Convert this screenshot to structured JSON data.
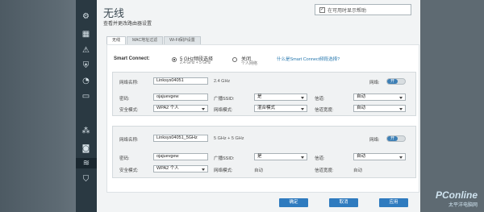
{
  "page": {
    "title": "无线",
    "subtitle": "查看并更改路由器设置",
    "help_checkbox_label": "在可用时显示帮助"
  },
  "tabs": [
    "无线",
    "MAC地址过滤",
    "Wi-Fi保护设置"
  ],
  "smart_connect": {
    "label": "Smart Connect:",
    "option_on": "5 GHz频段选择",
    "option_on_sub": "2.4 GHz + 5 GHz",
    "option_off": "关闭",
    "option_off_sub": "个人网络",
    "link": "什么是Smart Connect频段选择?"
  },
  "band1": {
    "ssid_label": "网络名称:",
    "ssid_value": "Linksys04051",
    "band": "2.4 GHz",
    "network_label": "网络:",
    "toggle": "开",
    "password_label": "密码:",
    "password_value": "ojajuevgew",
    "channel_width_label": "广播SSID:",
    "channel_width_value": "是",
    "channel_label": "信道:",
    "channel_value": "自动",
    "security_label": "安全模式:",
    "security_value": "WPA2 个人",
    "mode_label": "网络模式:",
    "mode_value": "混合模式",
    "width_label": "信道宽度:",
    "width_value": "自动"
  },
  "band2": {
    "ssid_label": "网络名称:",
    "ssid_value": "Linksys04051_5GHz",
    "band": "5 GHz + 5 GHz",
    "network_label": "网络:",
    "toggle": "开",
    "password_label": "密码:",
    "password_value": "ojajuevgew",
    "broadcast_label": "广播SSID:",
    "broadcast_value": "是",
    "channel_label": "信道:",
    "channel_value": "自动",
    "security_label": "安全模式:",
    "security_value": "WPA2 个人",
    "mode_label": "网络模式:",
    "mode_value": "自动",
    "width_label": "信道宽度:",
    "width_value": "自动"
  },
  "buttons": {
    "ok": "确定",
    "cancel": "取消",
    "apply": "应用"
  },
  "watermark": {
    "line1": "PConline",
    "line2": "太平洋电脑网"
  }
}
